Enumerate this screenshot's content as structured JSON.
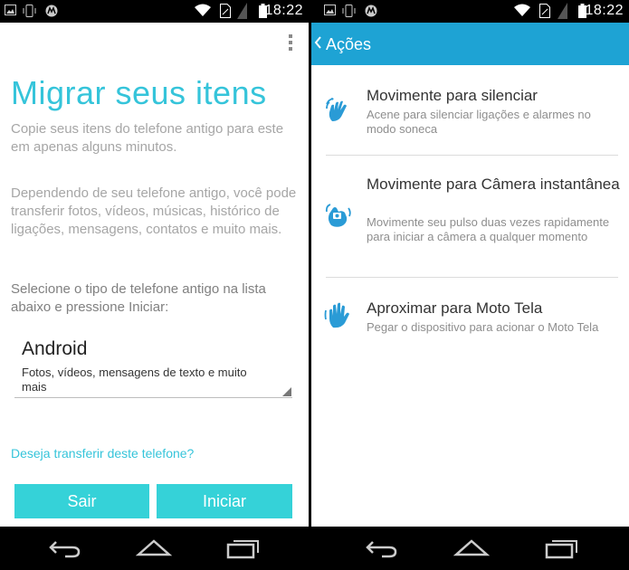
{
  "status": {
    "time": "18:22"
  },
  "left": {
    "title": "Migrar seus itens",
    "intro": "Copie seus itens do telefone antigo para este em apenas alguns minutos.",
    "description": "Dependendo de seu telefone antigo, você pode transferir fotos, vídeos, músicas, histórico de ligações, mensagens, contatos e muito mais.",
    "instruction": "Selecione o tipo de telefone antigo na lista abaixo e pressione Iniciar:",
    "dropdown": {
      "selected": "Android",
      "subtitle": "Fotos, vídeos, mensagens de texto e muito mais"
    },
    "transfer_link": "Deseja transferir deste telefone?",
    "exit_button": "Sair",
    "start_button": "Iniciar"
  },
  "right": {
    "action_bar_title": "Ações",
    "items": [
      {
        "title": "Movimente para silenciar",
        "subtitle": "Acene para silenciar ligações e alarmes no modo soneca",
        "icon": "wave-hand-icon"
      },
      {
        "title": "Movimente para Câmera instantânea",
        "subtitle": "Movimente seu pulso duas vezes rapidamente para iniciar a câmera a qualquer momento",
        "icon": "twist-camera-icon"
      },
      {
        "title": "Aproximar para Moto Tela",
        "subtitle": "Pegar o dispositivo para acionar o Moto Tela",
        "icon": "approach-hand-icon"
      }
    ]
  },
  "colors": {
    "accent": "#35c4da",
    "action_bar": "#1ea3d4",
    "button": "#35d2d8"
  }
}
